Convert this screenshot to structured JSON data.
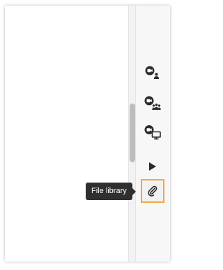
{
  "tooltip": {
    "text": "File library"
  },
  "toolbar": {
    "buttons": [
      {
        "name": "one-on-one-video-call",
        "icon": "video-call-person-icon",
        "active": false
      },
      {
        "name": "group-video-call",
        "icon": "video-call-group-icon",
        "active": false
      },
      {
        "name": "screen-share",
        "icon": "video-screen-share-icon",
        "active": false
      },
      {
        "name": "play",
        "icon": "play-icon",
        "active": false
      },
      {
        "name": "file-library",
        "icon": "paperclip-icon",
        "active": true
      }
    ]
  },
  "colors": {
    "icon": "#2b2b2b",
    "active_border": "#f4a73b",
    "tooltip_bg": "#2f2f2f",
    "toolbar_bg": "#f7f7f7",
    "scrollbar_thumb": "#bdbdbd"
  }
}
